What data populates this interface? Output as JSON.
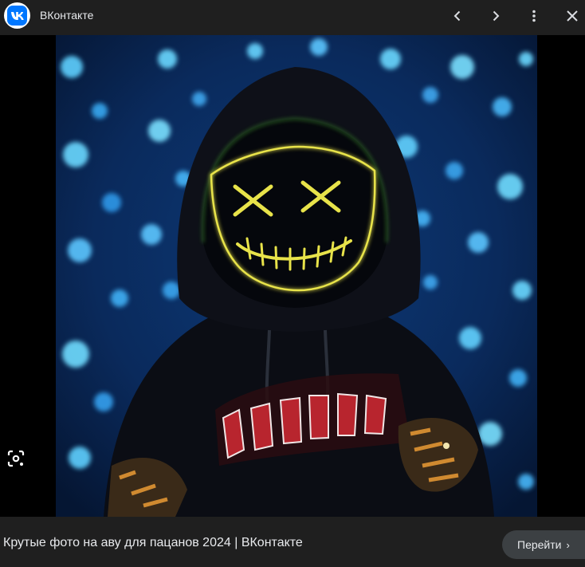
{
  "header": {
    "site_name": "ВКонтакте",
    "logo_icon": "vk-logo-icon",
    "actions": [
      {
        "name": "previous-button",
        "icon": "chevron-left-icon"
      },
      {
        "name": "next-button",
        "icon": "chevron-right-icon"
      },
      {
        "name": "more-options-button",
        "icon": "more-vert-icon"
      },
      {
        "name": "close-button",
        "icon": "close-icon"
      }
    ]
  },
  "image": {
    "subject": "masked-figure-in-hoodie",
    "mask_color": "#e8e34a",
    "background_color": "#0a2a55",
    "bokeh_color": "#58c8ff"
  },
  "lens": {
    "icon": "lens-search-icon"
  },
  "footer": {
    "caption": "Крутые фото на аву для пацанов 2024 | ВКонтакте",
    "visit_label": "Перейти",
    "visit_icon": "chevron-right-icon"
  },
  "colors": {
    "panel_bg": "#1f1f1f",
    "button_bg": "#3c4043",
    "vk_blue": "#0077ff",
    "text": "#e8eaed"
  }
}
